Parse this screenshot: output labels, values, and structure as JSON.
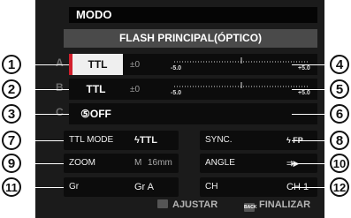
{
  "header": {
    "title": "MODO",
    "subtitle": "FLASH PRINCIPAL(ÓPTICO)"
  },
  "groups": [
    {
      "label": "A",
      "mode": "TTL",
      "ev": "±0",
      "scale_min": "-5.0",
      "scale_max": "+5.0"
    },
    {
      "label": "B",
      "mode": "TTL",
      "ev": "±0",
      "scale_min": "-5.0",
      "scale_max": "+5.0"
    },
    {
      "label": "C",
      "mode": "⑤OFF"
    }
  ],
  "settings": {
    "ttl_mode": {
      "label": "TTL MODE",
      "value": "ϟTTL"
    },
    "sync": {
      "label": "SYNC.",
      "value": "ϟ FP"
    },
    "zoom": {
      "label": "ZOOM",
      "value_prefix": "M",
      "value": "16mm"
    },
    "angle": {
      "label": "ANGLE",
      "value": "⇉▶"
    },
    "gr": {
      "label": "Gr",
      "value": "Gr A"
    },
    "ch": {
      "label": "CH",
      "value": "CH 1"
    }
  },
  "callouts": [
    "1",
    "2",
    "3",
    "4",
    "5",
    "6",
    "7",
    "8",
    "9",
    "10",
    "11",
    "12"
  ],
  "footer": {
    "adjust": "AJUSTAR",
    "finish": "FINALIZAR",
    "finish_key": "BACK"
  },
  "colors": {
    "accent": "#d21f2c",
    "panel": "#1b1b1b"
  }
}
